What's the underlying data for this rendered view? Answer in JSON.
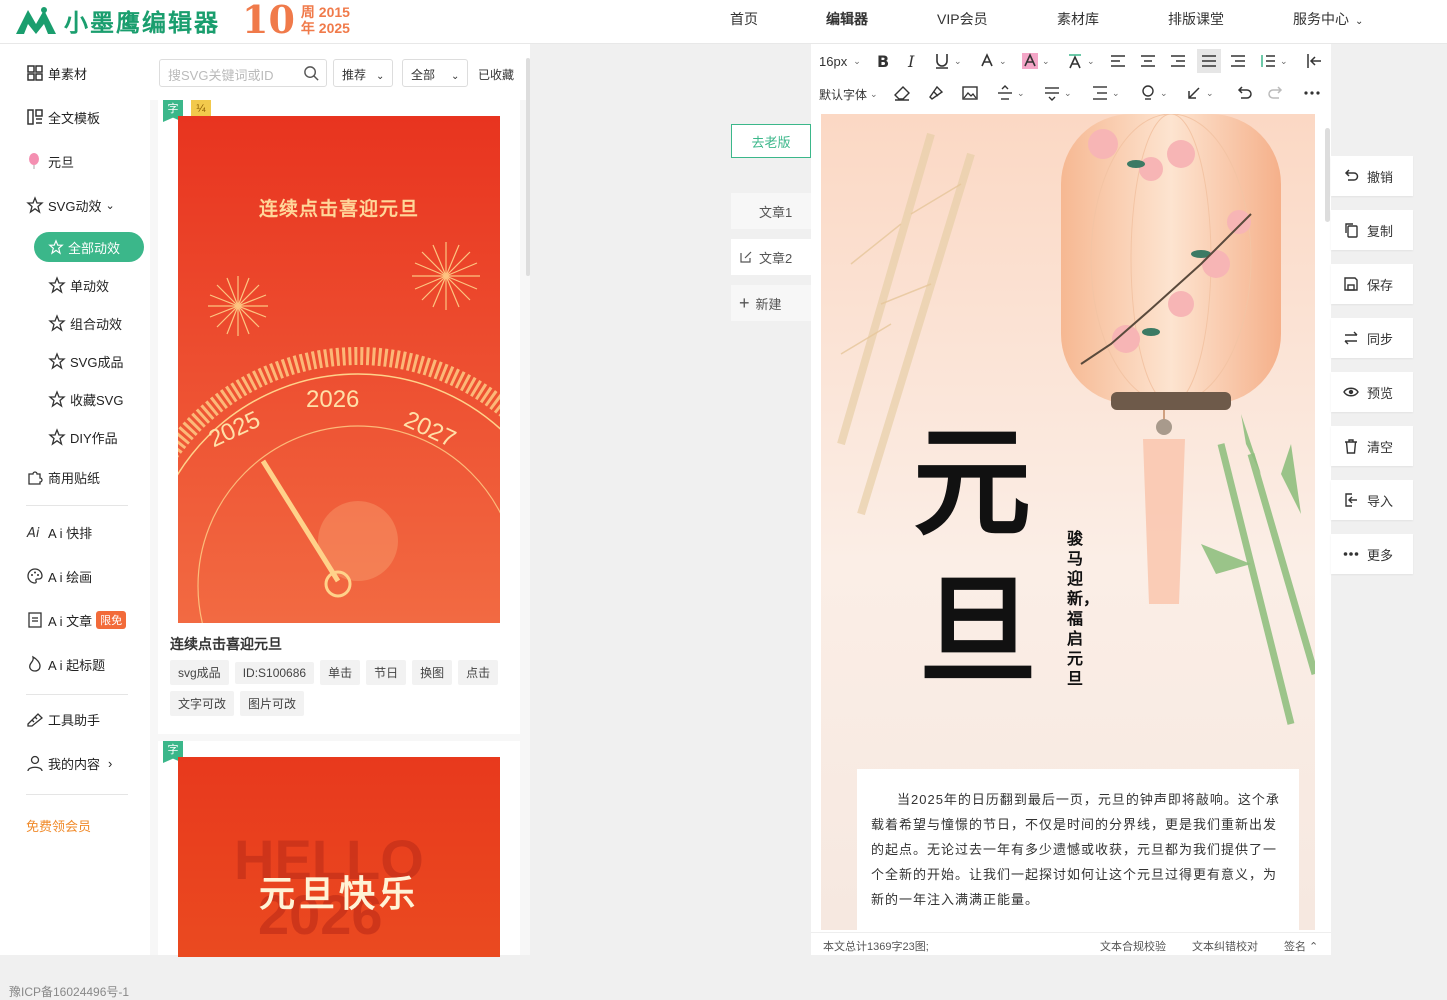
{
  "brand": {
    "name": "小墨鹰编辑器",
    "anniv_number": "10",
    "anniv_top": "周 2015",
    "anniv_bottom": "年 2025"
  },
  "nav": {
    "items": [
      "首页",
      "编辑器",
      "VIP会员",
      "素材库",
      "排版课堂",
      "服务中心"
    ],
    "active": "编辑器"
  },
  "sidebar": {
    "items": [
      "单素材",
      "全文模板",
      "元旦",
      "SVG动效",
      "全部动效",
      "单动效",
      "组合动效",
      "SVG成品",
      "收藏SVG",
      "DIY作品",
      "商用贴纸",
      "A i 快排",
      "A i 绘画",
      "A i 文章",
      "A i 起标题",
      "工具助手",
      "我的内容"
    ],
    "badge": "限免",
    "free_vip": "免费领会员",
    "icp": "豫ICP备16024496号-1"
  },
  "panel": {
    "search_placeholder": "搜SVG关键词或ID",
    "filter1": "推荐",
    "filter2": "全部",
    "fav": "已收藏",
    "card1": {
      "tag1": "字",
      "tag2": "¼",
      "poster_title": "连续点击喜迎元旦",
      "years": [
        "2025",
        "2026",
        "2027"
      ],
      "title": "连续点击喜迎元旦",
      "chips": [
        "svg成品",
        "ID:S100686",
        "单击",
        "节日",
        "换图",
        "点击",
        "文字可改",
        "图片可改"
      ]
    },
    "card2": {
      "tag1": "字",
      "poster_bg_text1": "HELLO",
      "poster_bg_text2": "2026",
      "poster_title": "元旦快乐"
    }
  },
  "articles": {
    "old_version": "去老版",
    "items": [
      "文章1",
      "文章2"
    ],
    "new": "新建"
  },
  "toolbar": {
    "font_size": "16px",
    "font_family": "默认字体"
  },
  "doc": {
    "big_chars": [
      "元",
      "旦"
    ],
    "side_text": "骏马迎新，福启元旦",
    "body": "当2025年的日历翻到最后一页，元旦的钟声即将敲响。这个承载着希望与憧憬的节日，不仅是时间的分界线，更是我们重新出发的起点。无论过去一年有多少遗憾或收获，元旦都为我们提供了一个全新的开始。让我们一起探讨如何让这个元旦过得更有意义，为新的一年注入满满正能量。"
  },
  "status": {
    "count": "本文总计1369字23图;",
    "check1": "文本合规校验",
    "check2": "文本纠错校对",
    "sign": "签名 ⌃"
  },
  "actions": [
    "撤销",
    "复制",
    "保存",
    "同步",
    "预览",
    "清空",
    "导入",
    "更多"
  ],
  "colors": {
    "brand": "#1a9e6e",
    "accent": "#3bb78a",
    "anniv": "#f07a4a",
    "poster_red": "#e8432a"
  }
}
